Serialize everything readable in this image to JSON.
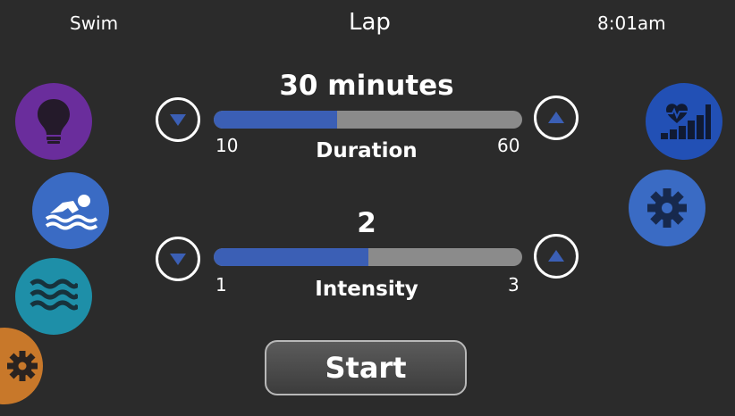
{
  "header": {
    "mode": "Swim",
    "title": "Lap",
    "time": "8:01am"
  },
  "duration": {
    "value_text": "30 minutes",
    "label": "Duration",
    "min": "10",
    "max": "60",
    "value": 30,
    "level_fraction": 0.4
  },
  "intensity": {
    "value_text": "2",
    "label": "Intensity",
    "min": "1",
    "max": "3",
    "value": 2,
    "level_fraction": 0.5
  },
  "start": {
    "label": "Start"
  },
  "left_menu": [
    {
      "icon": "lightbulb-icon",
      "color": "#6a2d9c"
    },
    {
      "icon": "swimmer-icon",
      "color": "#3a6bc4"
    },
    {
      "icon": "waves-icon",
      "color": "#1e8fa8"
    },
    {
      "icon": "gear-icon",
      "color": "#c8782a"
    }
  ],
  "right_menu": [
    {
      "icon": "heart-rate-chart-icon",
      "color": "#2250b5"
    },
    {
      "icon": "gear-icon",
      "color": "#3a6bc4"
    }
  ],
  "colors": {
    "background": "#2b2b2b",
    "slider_fill": "#3b5fb5",
    "slider_track": "#8b8b8b"
  }
}
